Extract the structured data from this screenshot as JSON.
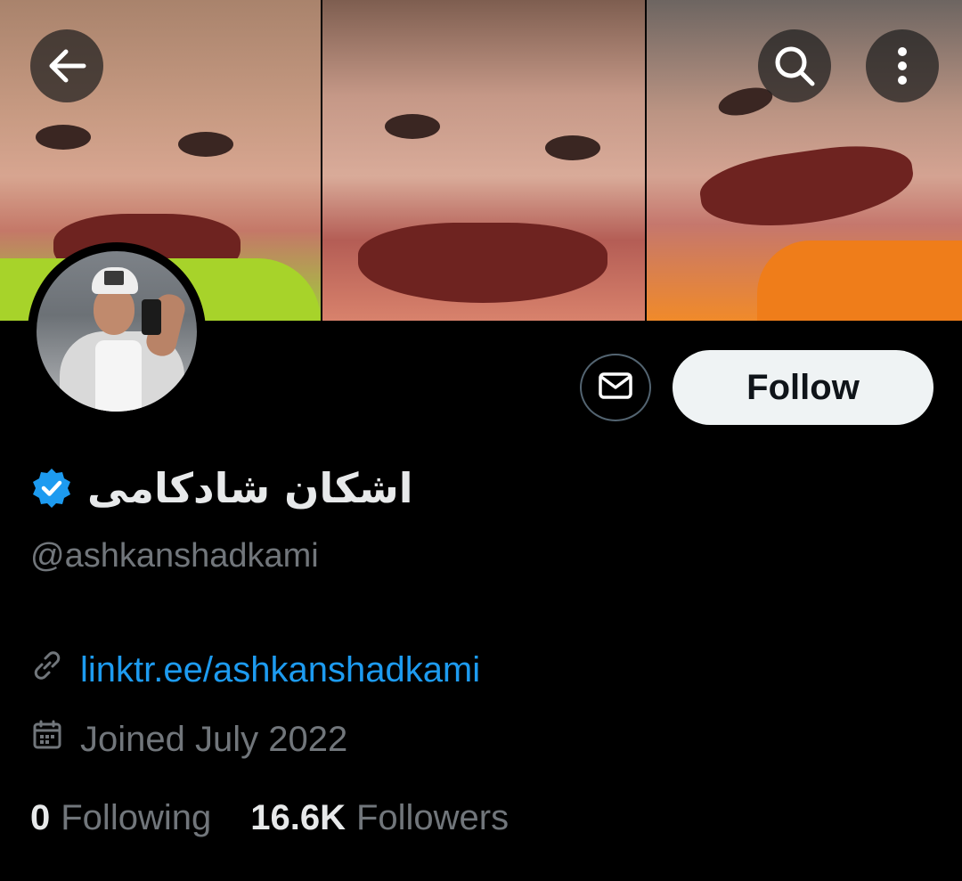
{
  "header": {
    "back_icon": "arrow-left-icon",
    "search_icon": "search-icon",
    "more_icon": "more-vertical-icon"
  },
  "banner": {
    "photos": [
      "banner-photo-1",
      "banner-photo-2",
      "banner-photo-3"
    ]
  },
  "actions": {
    "message_icon": "envelope-icon",
    "follow_label": "Follow"
  },
  "profile": {
    "display_name": "اشکان شادکامی",
    "verified": true,
    "handle": "@ashkanshadkami",
    "link": "linktr.ee/ashkanshadkami",
    "joined": "Joined July 2022"
  },
  "stats": {
    "following_count": "0",
    "following_label": "Following",
    "followers_count": "16.6K",
    "followers_label": "Followers"
  },
  "colors": {
    "background": "#000000",
    "primary_text": "#e7e9ea",
    "secondary_text": "#71767b",
    "link": "#1d9bf0",
    "verified_badge": "#1d9bf0",
    "follow_button_bg": "#eff3f4"
  }
}
